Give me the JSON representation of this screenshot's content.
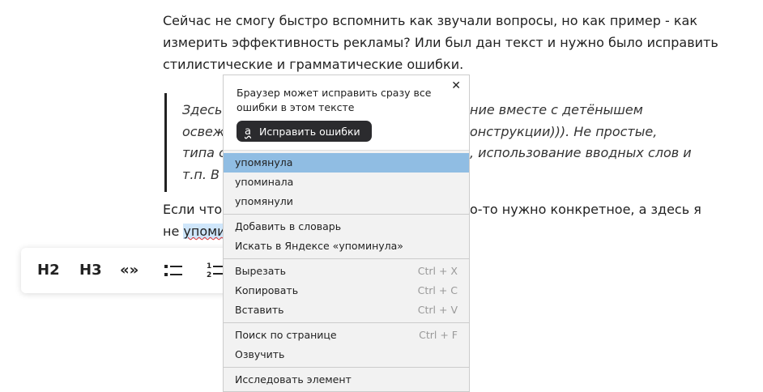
{
  "article": {
    "paragraph1": [
      "Сейчас не смогу быстро вспомнить как звучали вопросы, но как пример - как",
      "измерить эффективность рекламы? Или был дан текст и нужно было исправить",
      "стилистические и грамматические ошибки."
    ],
    "quote": [
      "Здесь я",
      "ние вместе с детёнышем",
      "освежи",
      "онструкции))). Не простые,",
      "типа с",
      ", использование вводных слов и",
      "т.п. В"
    ],
    "paragraph2_line1_start": "Если что",
    "paragraph2_line1_end": "о-то нужно конкретное, а здесь я",
    "paragraph2_line2_start": "не ",
    "misspelled_word": "упоми"
  },
  "toolbar": {
    "h2": "H2",
    "h3": "H3",
    "quote": "«»"
  },
  "context_menu": {
    "header_message": [
      "Браузер может исправить сразу все",
      "ошибки в этом тексте"
    ],
    "fix_button": "Исправить ошибки",
    "suggestions": [
      "упомянула",
      "упоминала",
      "упомянули"
    ],
    "dictionary": [
      "Добавить в словарь",
      "Искать в Яндексе «упоминула»"
    ],
    "edit": [
      {
        "label": "Вырезать",
        "shortcut": "Ctrl + X"
      },
      {
        "label": "Копировать",
        "shortcut": "Ctrl + C"
      },
      {
        "label": "Вставить",
        "shortcut": "Ctrl + V"
      }
    ],
    "search": [
      {
        "label": "Поиск по странице",
        "shortcut": "Ctrl + F"
      },
      {
        "label": "Озвучить",
        "shortcut": ""
      }
    ],
    "inspect": "Исследовать элемент"
  }
}
